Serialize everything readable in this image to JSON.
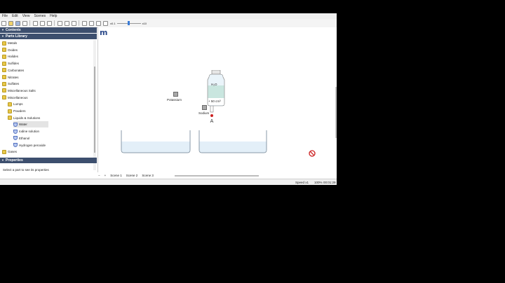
{
  "menu": [
    "File",
    "Edit",
    "View",
    "Scenes",
    "Help"
  ],
  "toolbar": {
    "zoom_min": "x0.1",
    "zoom_max": "x10",
    "zoom_level": 0.5
  },
  "panels": {
    "contents": "Contents",
    "parts_library": "Parts Library",
    "properties": "Properties"
  },
  "tree": [
    {
      "label": "Metals",
      "icon": "folder-icon",
      "level": 1
    },
    {
      "label": "Oxides",
      "icon": "folder-icon",
      "level": 1
    },
    {
      "label": "Halides",
      "icon": "folder-icon",
      "level": 1
    },
    {
      "label": "Sulfides",
      "icon": "folder-icon",
      "level": 1
    },
    {
      "label": "Carbonates",
      "icon": "folder-icon",
      "level": 1
    },
    {
      "label": "Nitrates",
      "icon": "folder-icon",
      "level": 1
    },
    {
      "label": "Sulfates",
      "icon": "folder-icon",
      "level": 1
    },
    {
      "label": "Miscellaneous Salts",
      "icon": "folder-icon",
      "level": 1
    },
    {
      "label": "Miscellaneous",
      "icon": "folder-open-icon",
      "level": 1
    },
    {
      "label": "Lumps",
      "icon": "folder-icon",
      "level": 2
    },
    {
      "label": "Powders",
      "icon": "folder-icon",
      "level": 2
    },
    {
      "label": "Liquids & Solutions",
      "icon": "folder-open-icon",
      "level": 2
    },
    {
      "label": "Water",
      "icon": "flask-icon",
      "level": 3,
      "selected": true
    },
    {
      "label": "Iodine solution",
      "icon": "flask-icon",
      "level": 3
    },
    {
      "label": "Ethanol",
      "icon": "flask-icon",
      "level": 3
    },
    {
      "label": "Hydrogen peroxide",
      "icon": "flask-icon",
      "level": 3
    },
    {
      "label": "Gases",
      "icon": "folder-icon",
      "level": 1
    }
  ],
  "properties_hint": "Select a part to see its properties",
  "canvas": {
    "logo": "m",
    "potassium_label": "Potassium",
    "sodium_label": "Sodium",
    "bottle_formula": "H₂O",
    "bottle_volume": "+ 50 cm³"
  },
  "scenes": {
    "add": "+",
    "remove": "−",
    "tabs": [
      "Scene 1",
      "Scene 2",
      "Scene 3"
    ]
  },
  "status": {
    "speed": "Speed x1",
    "zoom": "100%",
    "time": "00:01:29"
  }
}
